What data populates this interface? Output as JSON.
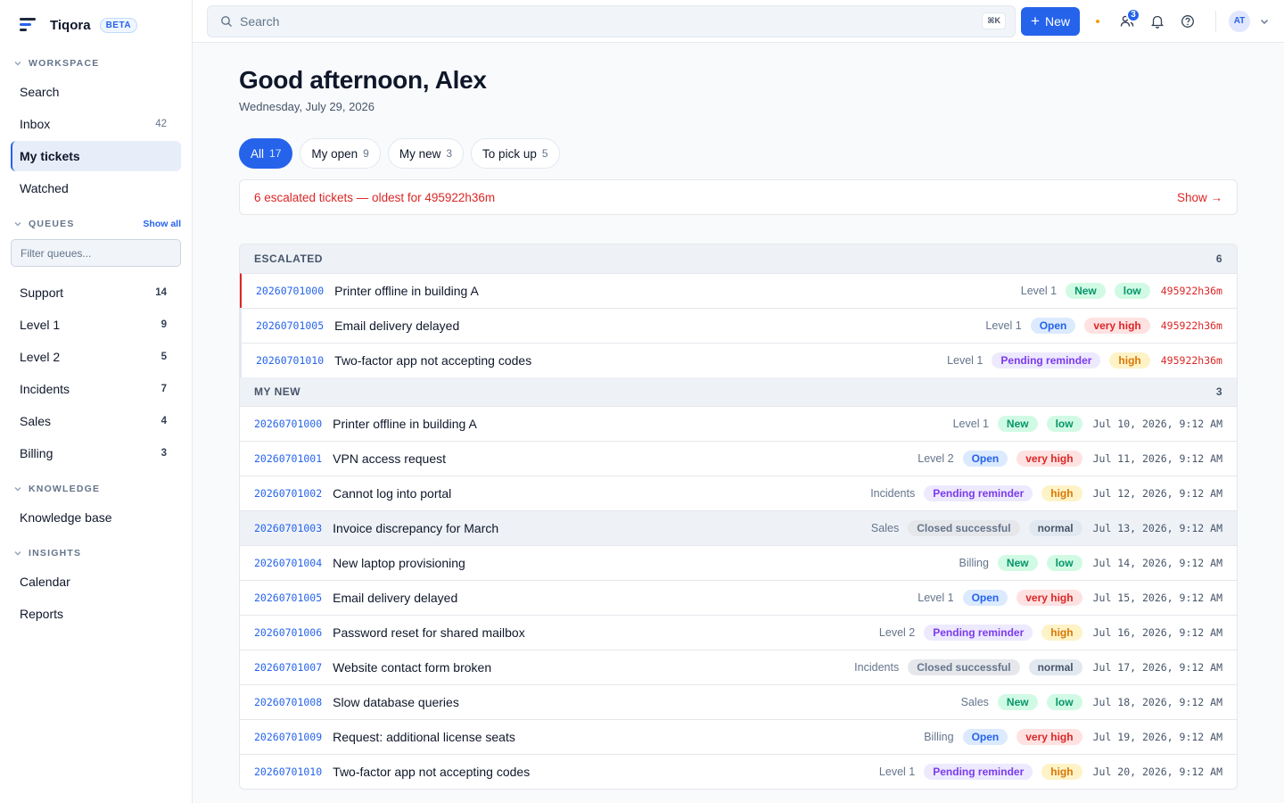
{
  "brand": {
    "name": "Tiqora",
    "beta": "BETA"
  },
  "sidebar": {
    "workspace_title": "WORKSPACE",
    "workspace": [
      {
        "label": "Search",
        "count": ""
      },
      {
        "label": "Inbox",
        "count": "42"
      },
      {
        "label": "My tickets",
        "count": ""
      },
      {
        "label": "Watched",
        "count": ""
      }
    ],
    "queues_title": "QUEUES",
    "queues_show_all": "Show all",
    "queue_filter_placeholder": "Filter queues...",
    "queues": [
      {
        "label": "Support",
        "count": "14"
      },
      {
        "label": "Level 1",
        "count": "9"
      },
      {
        "label": "Level 2",
        "count": "5"
      },
      {
        "label": "Incidents",
        "count": "7"
      },
      {
        "label": "Sales",
        "count": "4"
      },
      {
        "label": "Billing",
        "count": "3"
      }
    ],
    "knowledge_title": "KNOWLEDGE",
    "knowledge": [
      {
        "label": "Knowledge base"
      }
    ],
    "insights_title": "INSIGHTS",
    "insights": [
      {
        "label": "Calendar"
      },
      {
        "label": "Reports"
      }
    ]
  },
  "topbar": {
    "search_placeholder": "Search",
    "shortcut": "⌘K",
    "new_label": "New",
    "team_badge": "3",
    "avatar": "AT"
  },
  "main": {
    "greeting": "Good afternoon, Alex",
    "date": "Wednesday, July 29, 2026",
    "chips": [
      {
        "label": "All",
        "count": "17"
      },
      {
        "label": "My open",
        "count": "9"
      },
      {
        "label": "My new",
        "count": "3"
      },
      {
        "label": "To pick up",
        "count": "5"
      }
    ],
    "alert": {
      "text": "6 escalated tickets — oldest for 495922h36m",
      "action": "Show →"
    },
    "escalated": {
      "title": "ESCALATED",
      "count": "6",
      "rows": [
        {
          "id": "20260701000",
          "title": "Printer offline in building A",
          "queue": "Level 1",
          "state": "New",
          "priority": "low",
          "time": "495922h36m"
        },
        {
          "id": "20260701005",
          "title": "Email delivery delayed",
          "queue": "Level 1",
          "state": "Open",
          "priority": "very high",
          "time": "495922h36m"
        },
        {
          "id": "20260701010",
          "title": "Two-factor app not accepting codes",
          "queue": "Level 1",
          "state": "Pending reminder",
          "priority": "high",
          "time": "495922h36m"
        }
      ]
    },
    "mynew": {
      "title": "MY NEW",
      "count": "3",
      "rows": [
        {
          "id": "20260701000",
          "title": "Printer offline in building A",
          "queue": "Level 1",
          "state": "New",
          "priority": "low",
          "time": "Jul 10, 2026, 9:12 AM"
        },
        {
          "id": "20260701001",
          "title": "VPN access request",
          "queue": "Level 2",
          "state": "Open",
          "priority": "very high",
          "time": "Jul 11, 2026, 9:12 AM"
        },
        {
          "id": "20260701002",
          "title": "Cannot log into portal",
          "queue": "Incidents",
          "state": "Pending reminder",
          "priority": "high",
          "time": "Jul 12, 2026, 9:12 AM"
        },
        {
          "id": "20260701003",
          "title": "Invoice discrepancy for March",
          "queue": "Sales",
          "state": "Closed successful",
          "priority": "normal",
          "time": "Jul 13, 2026, 9:12 AM"
        },
        {
          "id": "20260701004",
          "title": "New laptop provisioning",
          "queue": "Billing",
          "state": "New",
          "priority": "low",
          "time": "Jul 14, 2026, 9:12 AM"
        },
        {
          "id": "20260701005",
          "title": "Email delivery delayed",
          "queue": "Level 1",
          "state": "Open",
          "priority": "very high",
          "time": "Jul 15, 2026, 9:12 AM"
        },
        {
          "id": "20260701006",
          "title": "Password reset for shared mailbox",
          "queue": "Level 2",
          "state": "Pending reminder",
          "priority": "high",
          "time": "Jul 16, 2026, 9:12 AM"
        },
        {
          "id": "20260701007",
          "title": "Website contact form broken",
          "queue": "Incidents",
          "state": "Closed successful",
          "priority": "normal",
          "time": "Jul 17, 2026, 9:12 AM"
        },
        {
          "id": "20260701008",
          "title": "Slow database queries",
          "queue": "Sales",
          "state": "New",
          "priority": "low",
          "time": "Jul 18, 2026, 9:12 AM"
        },
        {
          "id": "20260701009",
          "title": "Request: additional license seats",
          "queue": "Billing",
          "state": "Open",
          "priority": "very high",
          "time": "Jul 19, 2026, 9:12 AM"
        },
        {
          "id": "20260701010",
          "title": "Two-factor app not accepting codes",
          "queue": "Level 1",
          "state": "Pending reminder",
          "priority": "high",
          "time": "Jul 20, 2026, 9:12 AM"
        }
      ]
    }
  },
  "colors": {
    "accent": "#2563eb",
    "danger": "#dc2626",
    "state_new": "#059669",
    "state_open": "#2563eb",
    "state_pending": "#7c3aed",
    "state_closed": "#64748b",
    "prio_low": "#059669",
    "prio_very_high": "#dc2626",
    "prio_high": "#d97706",
    "prio_normal": "#475569"
  }
}
